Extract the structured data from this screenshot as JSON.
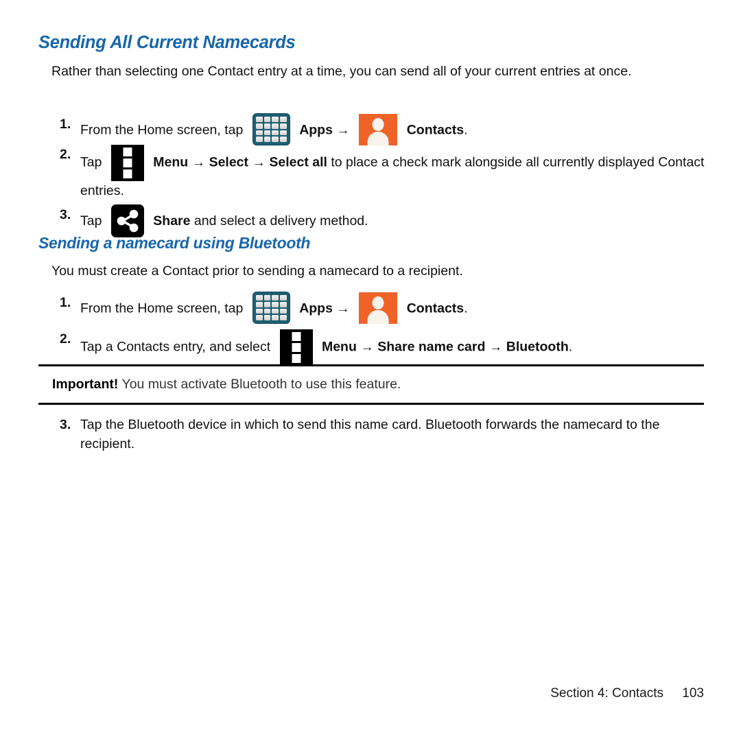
{
  "document": {
    "headings": {
      "section_1": "Sending All Current Namecards",
      "section_2": "Sending a namecard using Bluetooth"
    },
    "intro_paragraph": "Rather than selecting one Contact entry at a time, you can send all of your current entries at once.",
    "bluetooth_intro_paragraph": "You must create a Contact prior to sending a namecard to a recipient.",
    "steps_section_1": [
      {
        "number": "1.",
        "text_before_icon": "From the Home screen, tap",
        "icon_1": "apps-grid-icon",
        "label_1": "Apps",
        "arrow": "→",
        "icon_2": "contacts-icon",
        "label_2": "Contacts",
        "trailing": "."
      },
      {
        "number": "2.",
        "text_before_icon": "Tap",
        "icon_1": "menu-icon",
        "label_menu": "Menu",
        "arrow_1": "→",
        "label_select": "Select",
        "arrow_2": "→",
        "label_select_all": "Select all",
        "text_after": " to place a check mark alongside all currently displayed Contact entries."
      },
      {
        "number": "3.",
        "text_before_icon": "Tap",
        "icon_1": "share-icon",
        "label_share": "Share",
        "text_after": " and select a delivery method."
      }
    ],
    "steps_section_2": [
      {
        "number": "1.",
        "text_before_icon": "From the Home screen, tap",
        "icon_1": "apps-grid-icon",
        "label_1": "Apps",
        "arrow": "→",
        "icon_2": "contacts-icon",
        "label_2": "Contacts",
        "trailing": "."
      },
      {
        "number": "2.",
        "text_before_icon": "Tap a Contacts entry, and select",
        "icon_1": "menu-icon",
        "label_menu": "Menu",
        "arrow_1": "→",
        "label_share_name_card": "Share name card",
        "arrow_2": "→",
        "label_bluetooth": "Bluetooth",
        "trailing": "."
      },
      {
        "number": "3.",
        "text": "Tap the Bluetooth device in which to send this name card. Bluetooth forwards the namecard to the recipient."
      }
    ],
    "note": {
      "label": "Important!",
      "text": " You must activate Bluetooth to use this feature."
    },
    "footer": {
      "section_label": "Section 4:  Contacts",
      "page_number": "103"
    },
    "colors": {
      "heading_blue": "#1766ab",
      "apps_icon_teal": "#1d5e72",
      "contacts_icon_orange": "#ef6329",
      "icon_black": "#000000",
      "body_text": "#111111"
    }
  }
}
